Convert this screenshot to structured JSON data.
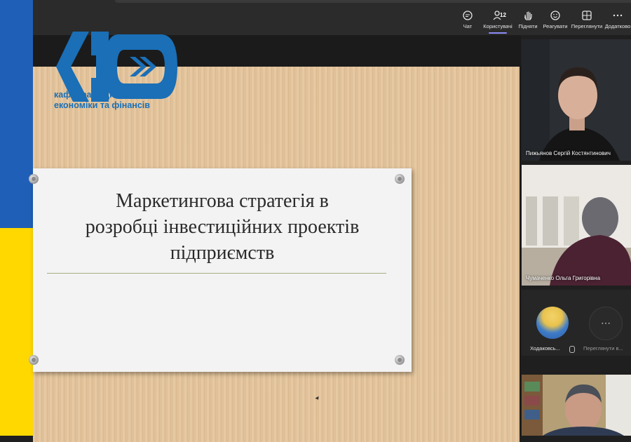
{
  "toolbar": {
    "chat": "Чат",
    "users": "Користувачі",
    "users_count": "12",
    "raise": "Підняти",
    "react": "Реагувати",
    "view": "Переглянути",
    "more": "Додатково"
  },
  "slide": {
    "logo_line1": "кафедра національної",
    "logo_line2": "економіки та фінансів",
    "title_line1": "Маркетингова стратегія в",
    "title_line2": "розробці інвестиційних проектів",
    "title_line3": "підприємств"
  },
  "participants": {
    "p1": "Пижьянов Сергій Костянтинович",
    "p2": "Чумаченко Ольга Григорівна",
    "p3": "Ходаковсь...",
    "p4": "Переглянути в..."
  },
  "colors": {
    "flag_blue": "#1f5fb7",
    "flag_yellow": "#ffd800",
    "logo_blue": "#1a6fb7",
    "accent": "#8b8cf7"
  }
}
